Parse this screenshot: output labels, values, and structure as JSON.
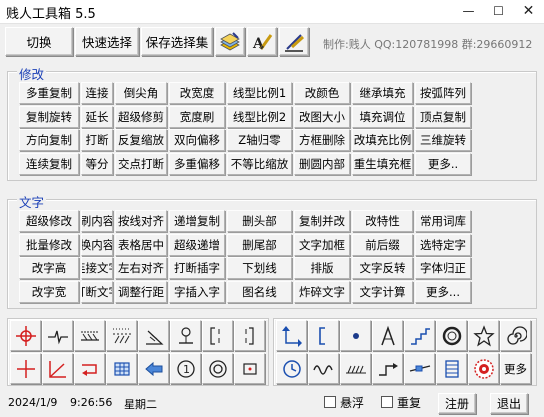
{
  "window": {
    "title": "贱人工具箱 5.5",
    "min": "—",
    "max": "☐",
    "close": "✕"
  },
  "topbar": {
    "buttons": [
      "切换",
      "快速选择",
      "保存选择集"
    ],
    "credit": "制作:贱人 QQ:120781998 群:29660912",
    "icon_names": [
      "layers-icon",
      "text-pen-icon",
      "text-edit-icon"
    ]
  },
  "modify": {
    "legend": "修改",
    "rows": [
      [
        "多重复制",
        "连接",
        "倒尖角",
        "改宽度",
        "线型比例1",
        "改颜色",
        "继承填充",
        "按弧阵列"
      ],
      [
        "复制旋转",
        "延长",
        "超级修剪",
        "宽度刷",
        "线型比例2",
        "改图大小",
        "填充调位",
        "顶点复制"
      ],
      [
        "方向复制",
        "打断",
        "反复缩放",
        "双向偏移",
        "Z轴归零",
        "方框删除",
        "改填充比例",
        "三维旋转"
      ],
      [
        "连续复制",
        "等分",
        "交点打断",
        "多重偏移",
        "不等比缩放",
        "删圆内部",
        "重生填充框",
        "更多.."
      ]
    ]
  },
  "text": {
    "legend": "文字",
    "rows": [
      [
        "超级修改",
        "刷内容",
        "按线对齐",
        "递增复制",
        "删头部",
        "复制并改",
        "改特性",
        "常用词库"
      ],
      [
        "批量修改",
        "换内容",
        "表格居中",
        "超级递增",
        "删尾部",
        "文字加框",
        "前后缀",
        "选特定字"
      ],
      [
        "改字高",
        "连接文字",
        "左右对齐",
        "打断插字",
        "下划线",
        "排版",
        "文字反转",
        "字体归正"
      ],
      [
        "改字宽",
        "打断文字",
        "调整行距",
        "字插入字",
        "图名线",
        "炸碎文字",
        "文字计算",
        "更多..."
      ]
    ]
  },
  "draw_icons": {
    "row1": [
      "crosshair-icon",
      "breakline-icon",
      "dimension-icon",
      "hatch-symbol-icon",
      "angle-mark-icon",
      "elevation-icon",
      "bracket-icon",
      "bracket-right-icon"
    ],
    "row2": [
      "red-axis-icon",
      "red-angle-icon",
      "red-arrow-icon",
      "table-grid-icon",
      "left-arrow-icon",
      "circled-one-icon",
      "target-circle-icon",
      "small-box-icon"
    ]
  },
  "tool_icons": {
    "row1": [
      "redo-arrow-icon",
      "bracket-line-icon",
      "dot-icon",
      "compass-icon",
      "stairs-icon",
      "ring-icon",
      "star-icon",
      "spiral-icon"
    ],
    "row2": [
      "clock-icon",
      "wave-icon",
      "spring-icon",
      "step-arrow-icon",
      "pipe-icon",
      "coil-icon",
      "gear-badge-icon",
      "more-label"
    ],
    "more_label": "更多"
  },
  "status": {
    "date": "2024/1/9",
    "time": "9:26:56",
    "weekday": "星期二",
    "float_label": "悬浮",
    "repeat_label": "重复",
    "register_label": "注册",
    "exit_label": "退出"
  }
}
